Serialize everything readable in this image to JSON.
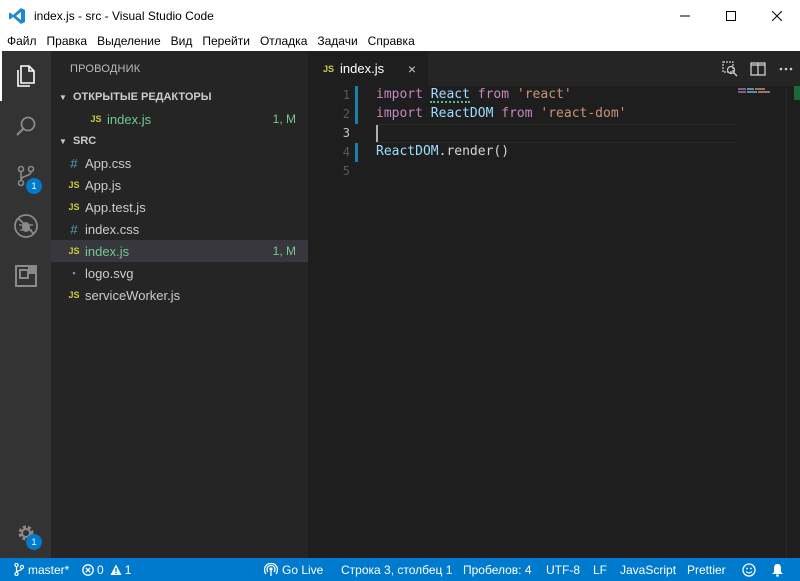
{
  "window": {
    "title": "index.js - src - Visual Studio Code",
    "controls": {
      "minimize": "—",
      "maximize": "☐",
      "close": "✕"
    }
  },
  "menu": [
    "Файл",
    "Правка",
    "Выделение",
    "Вид",
    "Перейти",
    "Отладка",
    "Задачи",
    "Справка"
  ],
  "activity": {
    "items": [
      "explorer-icon",
      "search-icon",
      "source-control-icon",
      "debug-icon",
      "extensions-icon"
    ],
    "source_control_badge": "1",
    "settings_badge": "1"
  },
  "sidebar": {
    "title": "ПРОВОДНИК",
    "open_editors": {
      "header": "ОТКРЫТЫЕ РЕДАКТОРЫ",
      "files": [
        {
          "icon": "JS",
          "name": "index.js",
          "status": "1, M"
        }
      ]
    },
    "src": {
      "header": "SRC",
      "files": [
        {
          "icon": "#",
          "type": "css",
          "name": "App.css",
          "status": ""
        },
        {
          "icon": "JS",
          "type": "js",
          "name": "App.js",
          "status": ""
        },
        {
          "icon": "JS",
          "type": "js",
          "name": "App.test.js",
          "status": ""
        },
        {
          "icon": "#",
          "type": "css",
          "name": "index.css",
          "status": ""
        },
        {
          "icon": "JS",
          "type": "js",
          "name": "index.js",
          "status": "1, M"
        },
        {
          "icon": "▪",
          "type": "svg",
          "name": "logo.svg",
          "status": ""
        },
        {
          "icon": "JS",
          "type": "js",
          "name": "serviceWorker.js",
          "status": ""
        }
      ]
    }
  },
  "editor": {
    "tab": {
      "icon": "JS",
      "label": "index.js",
      "close": "×"
    },
    "line_numbers": [
      "1",
      "2",
      "3",
      "4",
      "5"
    ],
    "lines": [
      [
        {
          "t": "import",
          "c": "kw"
        },
        {
          "t": " ",
          "c": "plain"
        },
        {
          "t": "React",
          "c": "var"
        },
        {
          "t": " ",
          "c": "plain"
        },
        {
          "t": "from",
          "c": "kw"
        },
        {
          "t": " ",
          "c": "plain"
        },
        {
          "t": "'react'",
          "c": "str"
        }
      ],
      [
        {
          "t": "import",
          "c": "kw"
        },
        {
          "t": " ",
          "c": "plain"
        },
        {
          "t": "ReactDOM",
          "c": "var"
        },
        {
          "t": " ",
          "c": "plain"
        },
        {
          "t": "from",
          "c": "kw"
        },
        {
          "t": " ",
          "c": "plain"
        },
        {
          "t": "'react-dom'",
          "c": "str"
        }
      ],
      [],
      [
        {
          "t": "ReactDOM",
          "c": "var"
        },
        {
          "t": ".render()",
          "c": "plain"
        }
      ],
      []
    ]
  },
  "statusbar": {
    "branch": "master*",
    "errors": "0",
    "warnings": "1",
    "go_live": "Go Live",
    "position": "Строка 3, столбец 1",
    "spaces": "Пробелов: 4",
    "encoding": "UTF-8",
    "eol": "LF",
    "language": "JavaScript",
    "formatter": "Prettier"
  },
  "colors": {
    "accent": "#007acc",
    "modified": "#73c991",
    "js_icon": "#cbcb41",
    "css_icon": "#519aba"
  }
}
